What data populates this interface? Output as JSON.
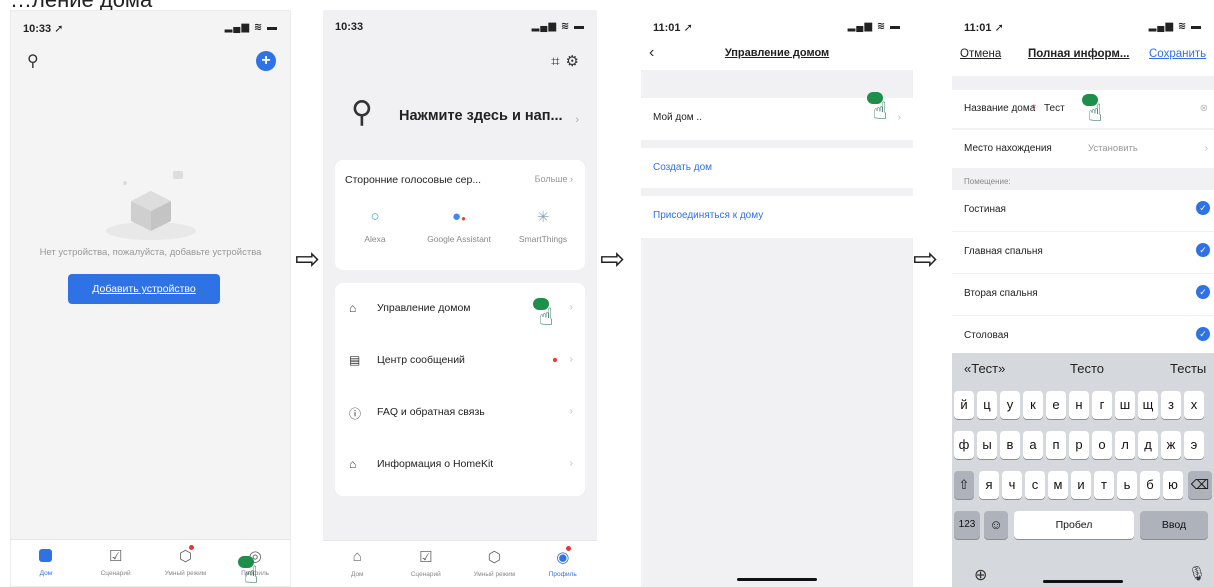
{
  "caption": "…ление дома",
  "screen1": {
    "status_time": "10:33 ➚",
    "status_icons": "▂▄▆ ≋ ▬",
    "user_icon": "user-icon",
    "add_icon": "plus-icon",
    "empty_text": "Нет устройства, пожалуйста, добавьте устройства",
    "add_button": "Добавить устройство",
    "tabs": [
      {
        "label": "Дом",
        "icon": "home-icon"
      },
      {
        "label": "Сценарий",
        "icon": "scene-icon"
      },
      {
        "label": "Умный режим",
        "icon": "smart-icon"
      },
      {
        "label": "Профиль",
        "icon": "profile-icon"
      }
    ]
  },
  "screen2": {
    "status_time": "10:33",
    "status_icons": "▂▄▆ ≋ ▬",
    "login_prompt": "Нажмите здесь и нап...",
    "voice_title": "Сторонние голосовые сер...",
    "voice_more": "Больше",
    "services": [
      {
        "name": "Alexa",
        "icon": "alexa-icon"
      },
      {
        "name": "Google Assistant",
        "icon": "google-assistant-icon"
      },
      {
        "name": "SmartThings",
        "icon": "smartthings-icon"
      }
    ],
    "menu": [
      {
        "label": "Управление домом",
        "icon": "home-outline-icon"
      },
      {
        "label": "Центр сообщений",
        "icon": "message-icon"
      },
      {
        "label": "FAQ и обратная связь",
        "icon": "question-icon"
      },
      {
        "label": "Информация о HomeKit",
        "icon": "homekit-icon"
      }
    ],
    "tabs": [
      {
        "label": "Дом"
      },
      {
        "label": "Сценарий"
      },
      {
        "label": "Умный режим"
      },
      {
        "label": "Профиль"
      }
    ]
  },
  "screen3": {
    "status_time": "11:01 ➚",
    "status_icons": "▂▄▆ ≋ ▬",
    "title": "Управление домом",
    "my_home": "Мой дом ..",
    "create_home": "Создать дом",
    "join_home": "Присоединяться к дому",
    "accent": "#2e72e6"
  },
  "screen4": {
    "status_time": "11:01 ➚",
    "status_icons": "▂▄▆ ≋ ▬",
    "cancel": "Отмена",
    "title": "Полная информ...",
    "save": "Сохранить",
    "home_name_label": "Название дома",
    "home_name_value": "Тест",
    "location_label": "Место нахождения",
    "location_placeholder": "Установить",
    "rooms_section": "Помещение:",
    "rooms": [
      "Гостиная",
      "Главная спальня",
      "Вторая спальня",
      "Столовая"
    ],
    "suggestions": [
      "«Тест»",
      "Тесто",
      "Тесты"
    ],
    "kb_row1": [
      "й",
      "ц",
      "у",
      "к",
      "е",
      "н",
      "г",
      "ш",
      "щ",
      "з",
      "х"
    ],
    "kb_row2": [
      "ф",
      "ы",
      "в",
      "а",
      "п",
      "р",
      "о",
      "л",
      "д",
      "ж",
      "э"
    ],
    "kb_row3": [
      "я",
      "ч",
      "с",
      "м",
      "и",
      "т",
      "ь",
      "б",
      "ю"
    ],
    "kb_123": "123",
    "kb_space": "Пробел",
    "kb_enter": "Ввод"
  }
}
